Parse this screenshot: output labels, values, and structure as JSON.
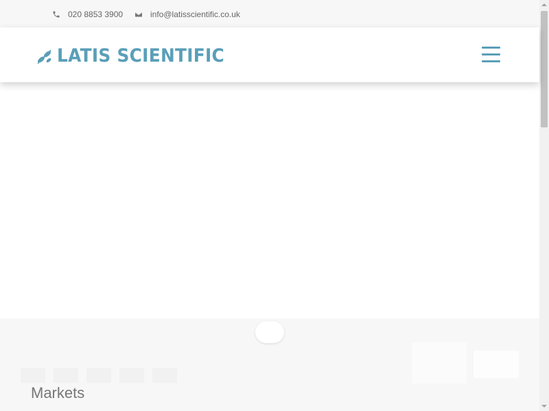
{
  "topbar": {
    "phone": "020 8853 3900",
    "email": "info@latisscientific.co.uk",
    "phone_icon": "phone-icon",
    "email_icon": "envelope-icon"
  },
  "header": {
    "brand": "LATIS SCIENTIFIC",
    "logo_icon": "leaf-logo-icon",
    "menu_icon": "hamburger-menu-icon",
    "brand_color": "#5a9fb8"
  },
  "section": {
    "heading": "Markets"
  }
}
